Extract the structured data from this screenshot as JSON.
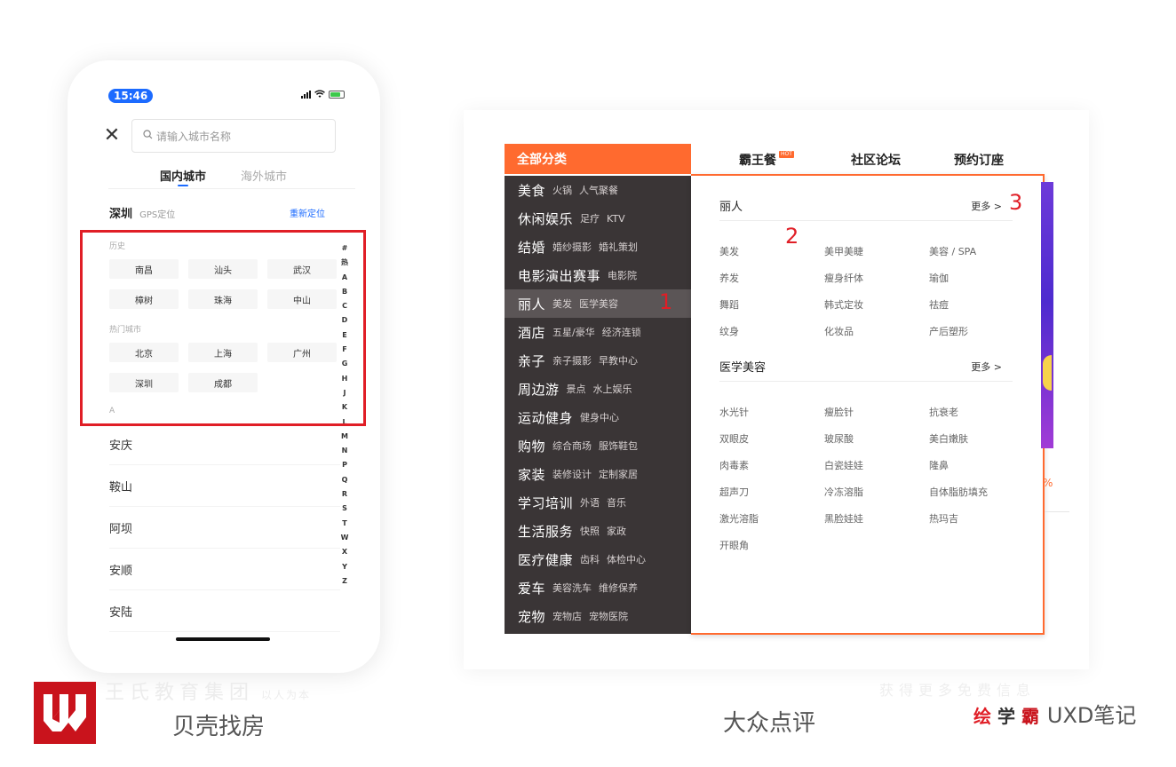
{
  "phone": {
    "status": {
      "time": "15:46"
    },
    "search": {
      "placeholder": "请输入城市名称"
    },
    "tabs": [
      {
        "label": "国内城市"
      },
      {
        "label": "海外城市"
      }
    ],
    "location": {
      "city": "深圳",
      "gps_label": "GPS定位",
      "relocate": "重新定位"
    },
    "history": {
      "label": "历史",
      "cities": [
        "南昌",
        "汕头",
        "武汉",
        "樟树",
        "珠海",
        "中山"
      ]
    },
    "hot": {
      "label": "热门城市",
      "cities": [
        "北京",
        "上海",
        "广州",
        "深圳",
        "成都"
      ]
    },
    "section_a": "A",
    "alpha_index": [
      "#",
      "热",
      "A",
      "B",
      "C",
      "D",
      "E",
      "F",
      "G",
      "H",
      "J",
      "K",
      "L",
      "M",
      "N",
      "P",
      "Q",
      "R",
      "S",
      "T",
      "W",
      "X",
      "Y",
      "Z"
    ],
    "list": [
      "安庆",
      "鞍山",
      "阿坝",
      "安顺",
      "安陆"
    ]
  },
  "dianping": {
    "header": "全部分类",
    "nav": [
      {
        "label": "霸王餐",
        "badge": "HOT"
      },
      {
        "label": "社区论坛"
      },
      {
        "label": "预约订座"
      }
    ],
    "categories": [
      {
        "main": "美食",
        "subs": [
          "火锅",
          "人气聚餐"
        ]
      },
      {
        "main": "休闲娱乐",
        "subs": [
          "足疗",
          "KTV"
        ]
      },
      {
        "main": "结婚",
        "subs": [
          "婚纱摄影",
          "婚礼策划"
        ]
      },
      {
        "main": "电影演出赛事",
        "subs": [
          "电影院"
        ]
      },
      {
        "main": "丽人",
        "subs": [
          "美发",
          "医学美容"
        ]
      },
      {
        "main": "酒店",
        "subs": [
          "五星/豪华",
          "经济连锁"
        ]
      },
      {
        "main": "亲子",
        "subs": [
          "亲子摄影",
          "早教中心"
        ]
      },
      {
        "main": "周边游",
        "subs": [
          "景点",
          "水上娱乐"
        ]
      },
      {
        "main": "运动健身",
        "subs": [
          "健身中心"
        ]
      },
      {
        "main": "购物",
        "subs": [
          "综合商场",
          "服饰鞋包"
        ]
      },
      {
        "main": "家装",
        "subs": [
          "装修设计",
          "定制家居"
        ]
      },
      {
        "main": "学习培训",
        "subs": [
          "外语",
          "音乐"
        ]
      },
      {
        "main": "生活服务",
        "subs": [
          "快照",
          "家政"
        ]
      },
      {
        "main": "医疗健康",
        "subs": [
          "齿科",
          "体检中心"
        ]
      },
      {
        "main": "爱车",
        "subs": [
          "美容洗车",
          "维修保养"
        ]
      },
      {
        "main": "宠物",
        "subs": [
          "宠物店",
          "宠物医院"
        ]
      }
    ],
    "flyout": {
      "sections": [
        {
          "title": "丽人",
          "more": "更多 >",
          "items": [
            "美发",
            "美甲美睫",
            "美容 / SPA",
            "养发",
            "瘦身纤体",
            "瑜伽",
            "舞蹈",
            "韩式定妆",
            "祛痘",
            "纹身",
            "化妆品",
            "产后塑形"
          ]
        },
        {
          "title": "医学美容",
          "more": "更多 >",
          "items": [
            "水光针",
            "瘦脸针",
            "抗衰老",
            "双眼皮",
            "玻尿酸",
            "美白嫩肤",
            "肉毒素",
            "白瓷娃娃",
            "隆鼻",
            "超声刀",
            "冷冻溶脂",
            "自体脂肪填充",
            "激光溶脂",
            "黑脸娃娃",
            "热玛吉",
            "开眼角"
          ]
        }
      ]
    }
  },
  "annotations": [
    "1",
    "2",
    "3"
  ],
  "captions": {
    "left": "贝壳找房",
    "right": "大众点评"
  },
  "watermarks": {
    "left": "王氏教育集团",
    "left_small": "以人为本",
    "right": "获得更多免费信息"
  },
  "brand": {
    "c1": "绘",
    "c2": "学",
    "c3": "霸",
    "c4": "UXD笔记"
  },
  "colors": {
    "accent_orange": "#ff6a2f",
    "annotation_red": "#e01e26",
    "phone_blue": "#1c6bff",
    "category_bg": "#3a3536"
  }
}
